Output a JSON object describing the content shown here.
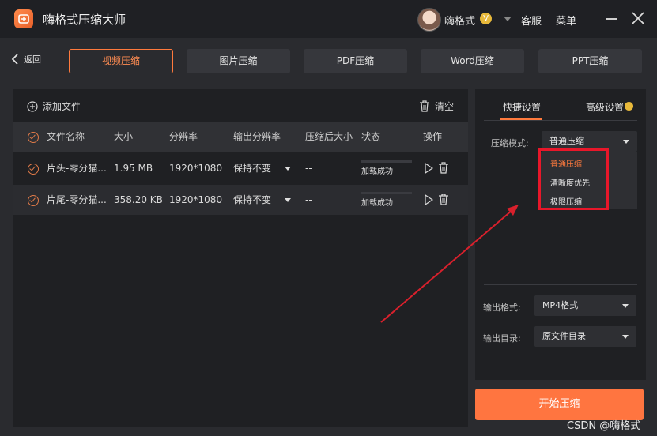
{
  "app": {
    "title": "嗨格式压缩大师",
    "username": "嗨格式",
    "vip_badge": "V",
    "service": "客服",
    "menu": "菜单"
  },
  "nav": {
    "back": "返回",
    "tabs": [
      "视频压缩",
      "图片压缩",
      "PDF压缩",
      "Word压缩",
      "PPT压缩"
    ]
  },
  "toolbar": {
    "add_file": "添加文件",
    "clear": "清空"
  },
  "table": {
    "headers": [
      "文件名称",
      "大小",
      "分辨率",
      "输出分辨率",
      "压缩后大小",
      "状态",
      "操作"
    ],
    "rows": [
      {
        "name": "片头-零分猫...",
        "size": "1.95 MB",
        "resolution": "1920*1080",
        "output_resolution": "保持不变",
        "compressed_size": "--",
        "status": "加载成功"
      },
      {
        "name": "片尾-零分猫...",
        "size": "358.20 KB",
        "resolution": "1920*1080",
        "output_resolution": "保持不变",
        "compressed_size": "--",
        "status": "加载成功"
      }
    ]
  },
  "settings": {
    "tab_quick": "快捷设置",
    "tab_advanced": "高级设置",
    "mode_label": "压缩模式:",
    "mode_value": "普通压缩",
    "mode_options": [
      "普通压缩",
      "清晰度优先",
      "极限压缩"
    ],
    "format_label": "输出格式:",
    "format_value": "MP4格式",
    "dir_label": "输出目录:",
    "dir_value": "原文件目录"
  },
  "start_button": "开始压缩",
  "watermark": "CSDN @嗨格式",
  "colors": {
    "accent": "#ff7a3d",
    "highlight_box": "#e8172a",
    "annotation_arrow": "#d8202c"
  }
}
